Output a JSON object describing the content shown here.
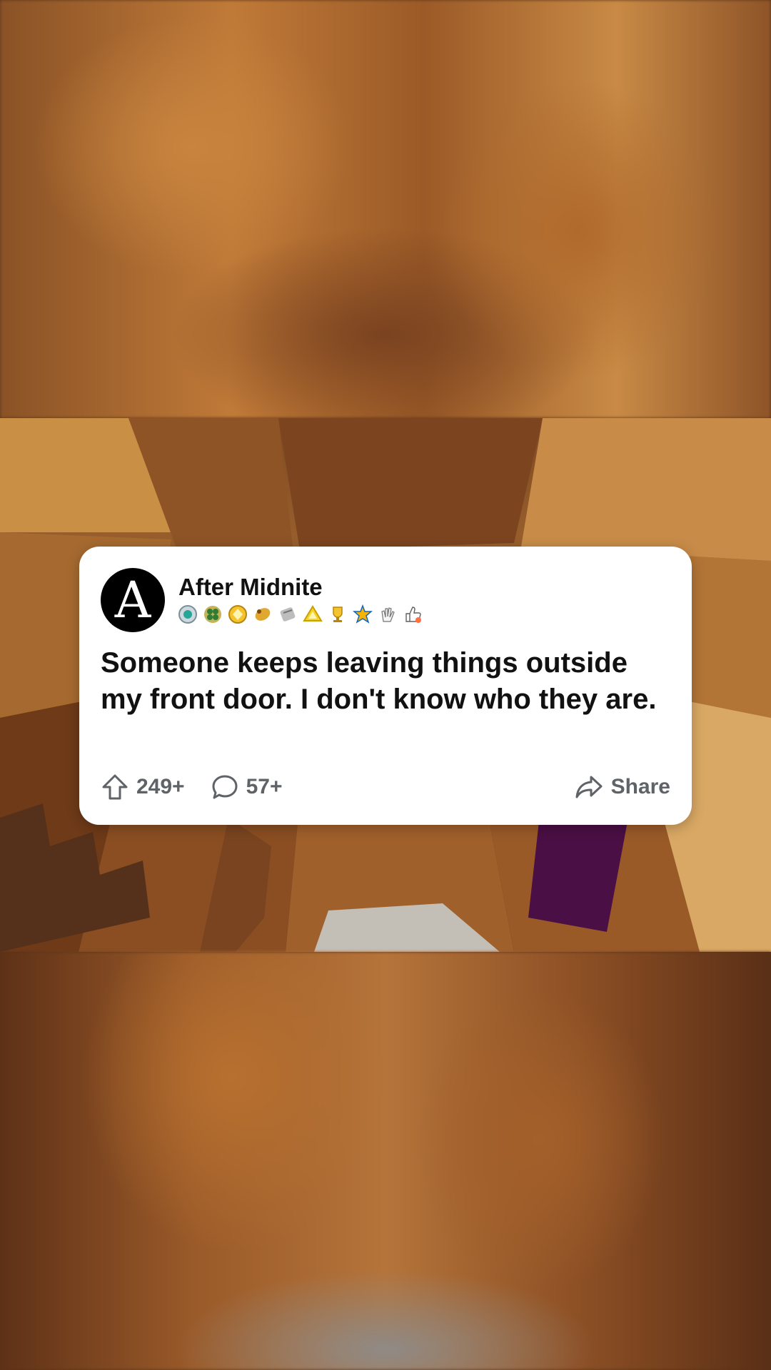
{
  "post": {
    "author": "After Midnite",
    "avatar_letter": "A",
    "badges": [
      "compass-badge-icon",
      "clover-badge-icon",
      "helmet-badge-icon",
      "bird-badge-icon",
      "scroll-badge-icon",
      "pyramid-badge-icon",
      "trophy-badge-icon",
      "star-badge-icon",
      "clap-badge-icon",
      "thumbs-up-badge-icon"
    ],
    "title": "Someone keeps leaving things outside my front door. I don't know who they are.",
    "upvotes": "249+",
    "comments": "57+",
    "share_label": "Share"
  },
  "colors": {
    "card_bg": "#ffffff",
    "text_primary": "#111111",
    "text_secondary": "#5f6368"
  }
}
